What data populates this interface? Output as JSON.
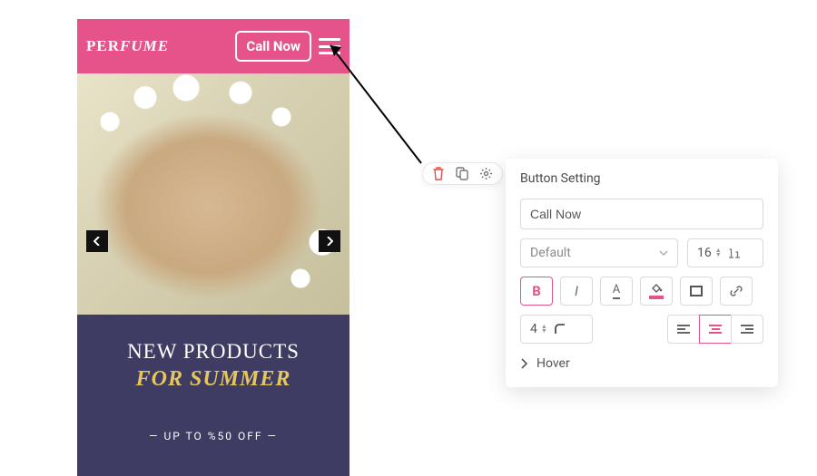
{
  "mobile": {
    "brand_part1": "PER",
    "brand_part2": "FUME",
    "call_button": "Call Now",
    "promo_line1": "NEW PRODUCTS",
    "promo_line2": "FOR SUMMER",
    "promo_off": "— UP TO %50 OFF —"
  },
  "panel": {
    "title": "Button Setting",
    "text_value": "Call Now",
    "font_family": "Default",
    "font_size": "16",
    "border_radius": "4",
    "hover_label": "Hover",
    "colors": {
      "accent": "#e6538b",
      "fill": "#e6538b",
      "text": "#555555"
    },
    "alignment": "center",
    "bold_active": true
  }
}
